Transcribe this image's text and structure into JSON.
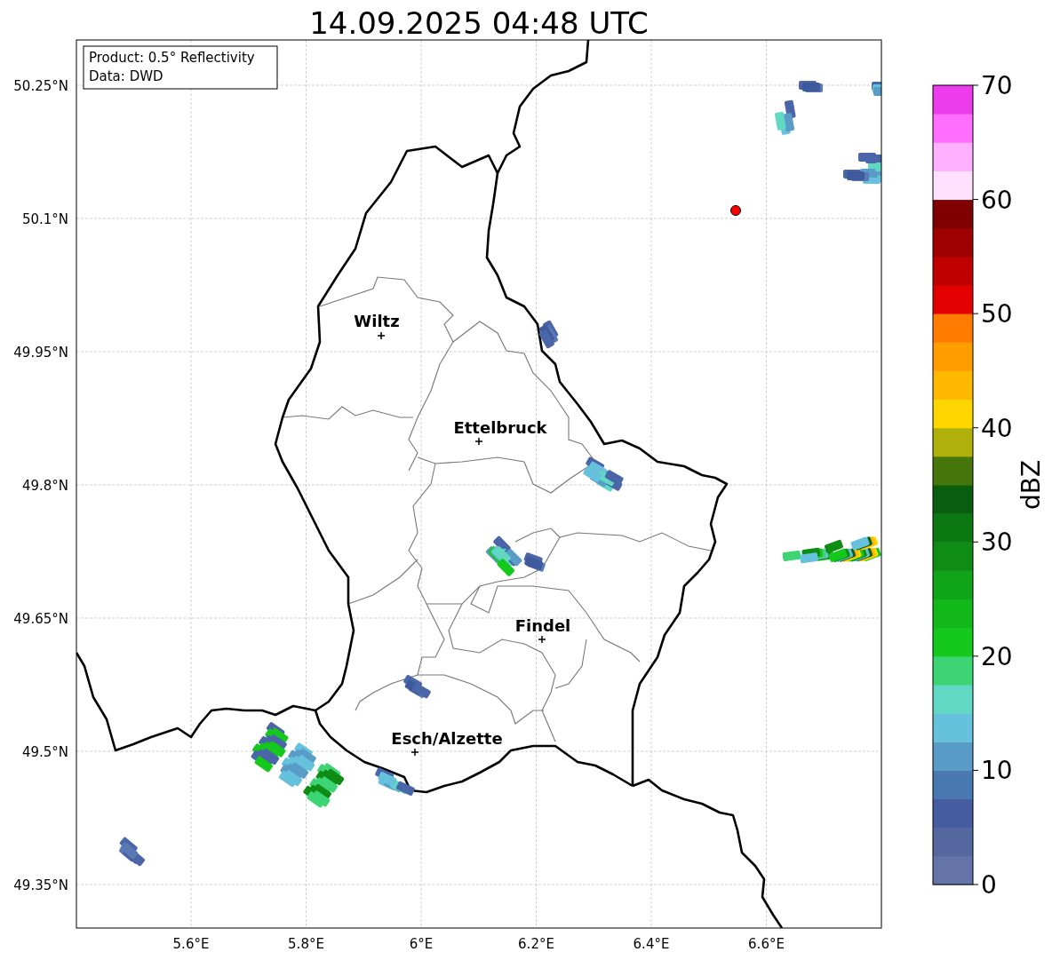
{
  "title": "14.09.2025 04:48 UTC",
  "info_box": [
    "Product: 0.5° Reflectivity",
    "Data: DWD"
  ],
  "y_ticks": [
    "50.25°N",
    "50.1°N",
    "49.95°N",
    "49.8°N",
    "49.65°N",
    "49.5°N",
    "49.35°N"
  ],
  "x_ticks": [
    "5.6°E",
    "5.8°E",
    "6°E",
    "6.2°E",
    "6.4°E",
    "6.6°E"
  ],
  "cities": [
    {
      "name": "Wiltz"
    },
    {
      "name": "Ettelbruck"
    },
    {
      "name": "Findel"
    },
    {
      "name": "Esch/Alzette"
    }
  ],
  "colorbar": {
    "label": "dBZ",
    "ticks": [
      "70",
      "60",
      "50",
      "40",
      "30",
      "20",
      "10",
      "0"
    ],
    "bands": [
      {
        "color": "#6474a8"
      },
      {
        "color": "#55679f"
      },
      {
        "color": "#455da0"
      },
      {
        "color": "#4a78b0"
      },
      {
        "color": "#5a9cc8"
      },
      {
        "color": "#66c2dc"
      },
      {
        "color": "#60d8c4"
      },
      {
        "color": "#3dd474"
      },
      {
        "color": "#14c81c"
      },
      {
        "color": "#12b81a"
      },
      {
        "color": "#10a418"
      },
      {
        "color": "#0e8c14"
      },
      {
        "color": "#0c7812"
      },
      {
        "color": "#095e0f"
      },
      {
        "color": "#46760c"
      },
      {
        "color": "#b0b00a"
      },
      {
        "color": "#ffd700"
      },
      {
        "color": "#ffb800"
      },
      {
        "color": "#ff9c00"
      },
      {
        "color": "#ff7c00"
      },
      {
        "color": "#e30000"
      },
      {
        "color": "#c00000"
      },
      {
        "color": "#9e0000"
      },
      {
        "color": "#7e0000"
      },
      {
        "color": "#ffe0ff"
      },
      {
        "color": "#ffb0ff"
      },
      {
        "color": "#ff6eff"
      },
      {
        "color": "#ec3cec"
      }
    ]
  }
}
